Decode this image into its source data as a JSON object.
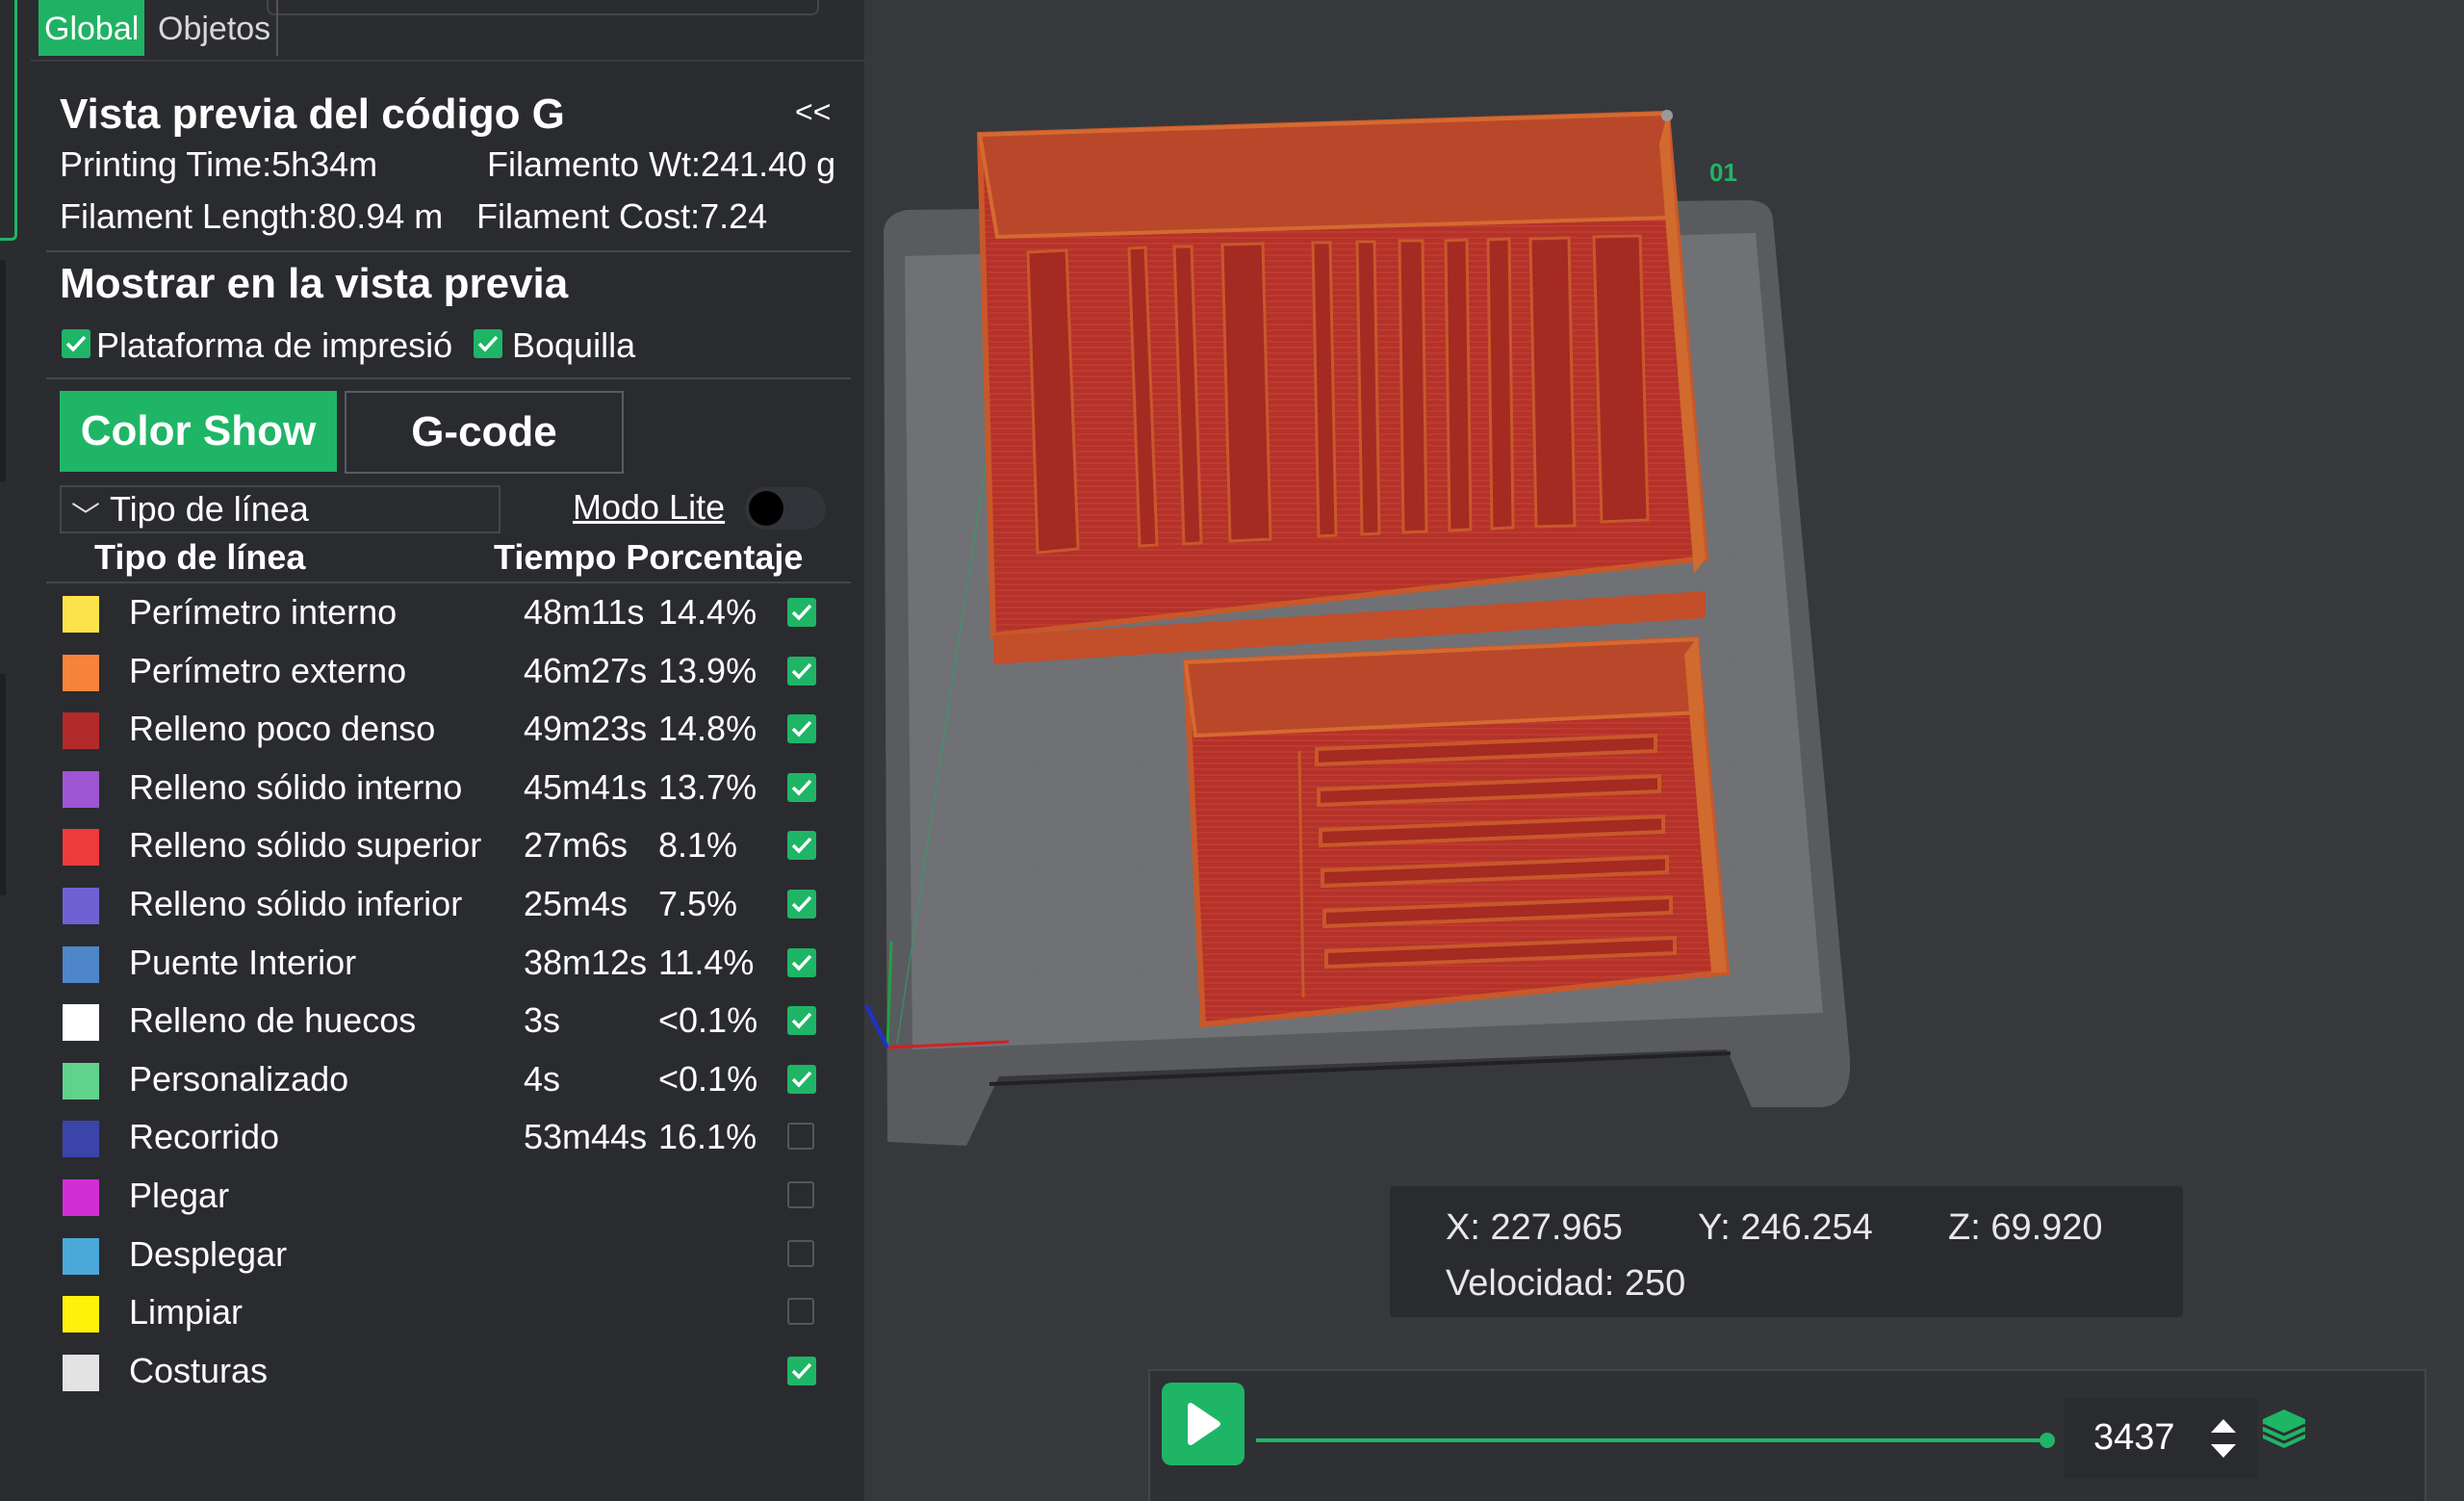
{
  "tabs": {
    "global": "Global",
    "objects": "Objetos"
  },
  "preview": {
    "title": "Vista previa del código G",
    "collapse": "<<",
    "printing_time": "Printing Time:5h34m",
    "filament_wt": "Filamento Wt:241.40 g",
    "filament_length": "Filament Length:80.94 m",
    "filament_cost": "Filament Cost:7.24"
  },
  "show": {
    "title": "Mostrar en la vista previa",
    "bed": "Plataforma de impresió",
    "bed_checked": true,
    "nozzle": "Boquilla",
    "nozzle_checked": true
  },
  "buttons": {
    "color_show": "Color Show",
    "gcode": "G-code"
  },
  "line_type_dropdown": "Tipo de línea",
  "lite_mode": {
    "label": "Modo Lite",
    "on": false
  },
  "table": {
    "col_type": "Tipo de línea",
    "col_time_pct": "Tiempo Porcentaje",
    "rows": [
      {
        "name": "Perímetro interno",
        "time": "48m11s",
        "pct": "14.4%",
        "color": "#fce34a",
        "checked": true
      },
      {
        "name": "Perímetro externo",
        "time": "46m27s",
        "pct": "13.9%",
        "color": "#f8833b",
        "checked": true
      },
      {
        "name": "Relleno poco denso",
        "time": "49m23s",
        "pct": "14.8%",
        "color": "#b32a2a",
        "checked": true
      },
      {
        "name": "Relleno sólido interno",
        "time": "45m41s",
        "pct": "13.7%",
        "color": "#9d55d1",
        "checked": true
      },
      {
        "name": "Relleno sólido superior",
        "time": "27m6s",
        "pct": "8.1%",
        "color": "#ee3b3b",
        "checked": true
      },
      {
        "name": "Relleno sólido inferior",
        "time": "25m4s",
        "pct": "7.5%",
        "color": "#7060d4",
        "checked": true
      },
      {
        "name": "Puente Interior",
        "time": "38m12s",
        "pct": "11.4%",
        "color": "#4e86c9",
        "checked": true
      },
      {
        "name": "Relleno de huecos",
        "time": "3s",
        "pct": "<0.1%",
        "color": "#ffffff",
        "checked": true
      },
      {
        "name": "Personalizado",
        "time": "4s",
        "pct": "<0.1%",
        "color": "#5fd38c",
        "checked": true
      },
      {
        "name": "Recorrido",
        "time": "53m44s",
        "pct": "16.1%",
        "color": "#3b44a8",
        "checked": false
      },
      {
        "name": "Plegar",
        "time": "",
        "pct": "",
        "color": "#d12ed6",
        "checked": false
      },
      {
        "name": "Desplegar",
        "time": "",
        "pct": "",
        "color": "#4aa9d8",
        "checked": false
      },
      {
        "name": "Limpiar",
        "time": "",
        "pct": "",
        "color": "#fcf20a",
        "checked": false
      },
      {
        "name": "Costuras",
        "time": "",
        "pct": "",
        "color": "#e3e3e3",
        "checked": true
      }
    ]
  },
  "viewport": {
    "object_label": "01"
  },
  "info": {
    "x": "X: 227.965",
    "y": "Y: 246.254",
    "z": "Z: 69.920",
    "speed": "Velocidad: 250"
  },
  "slider": {
    "layer": "3437"
  },
  "colors": {
    "accent": "#1fb566",
    "panel": "#2a2b2f",
    "background": "#37383c",
    "model": "#b7362c",
    "model_edge": "#c8582a"
  }
}
